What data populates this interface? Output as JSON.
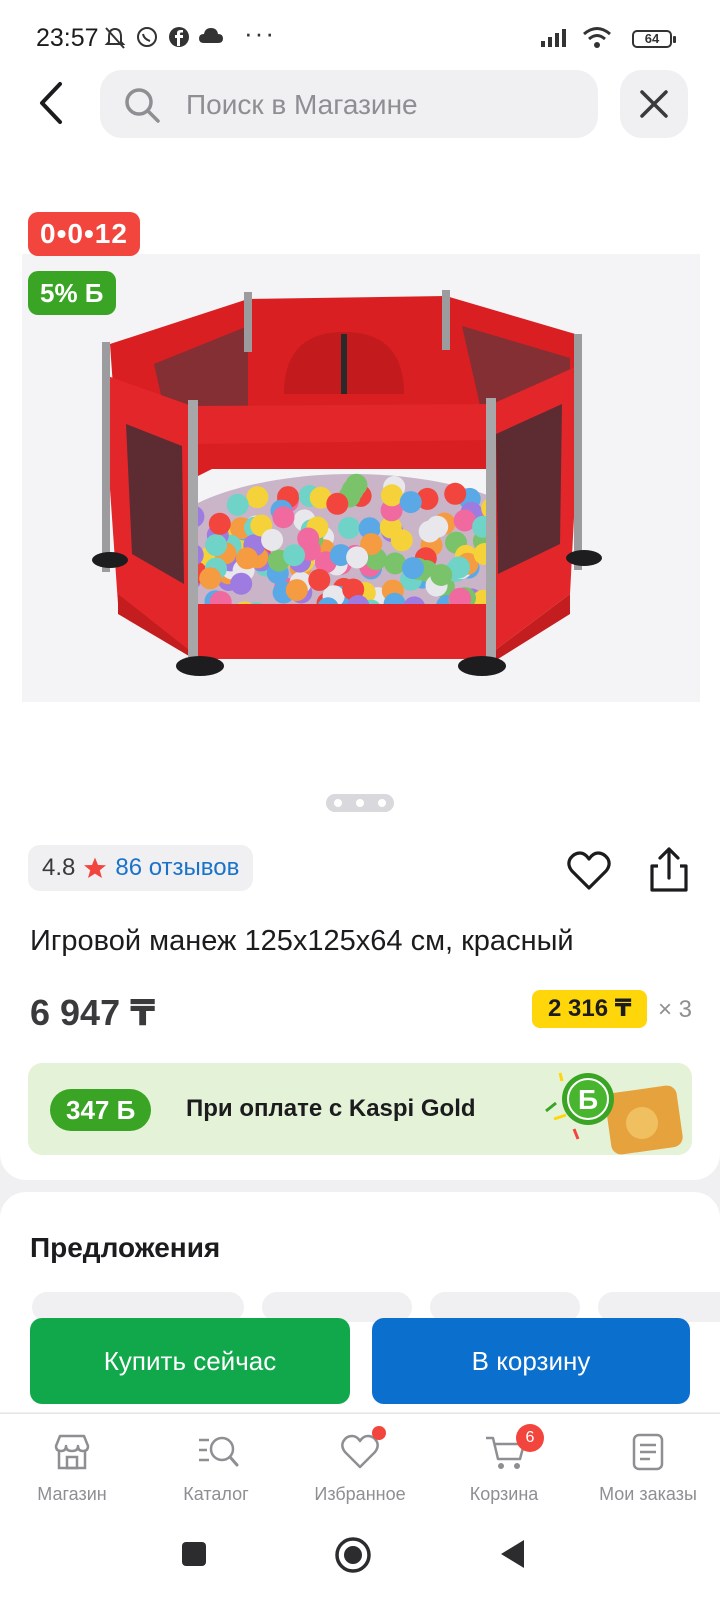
{
  "status_bar": {
    "time": "23:57",
    "battery": "64",
    "icons": [
      "mute-bell-icon",
      "whatsapp-icon",
      "facebook-icon",
      "cloud-icon",
      "more-icon",
      "signal-icon",
      "wifi-icon",
      "battery-icon"
    ],
    "more": "···"
  },
  "header": {
    "search_placeholder": "Поиск в Магазине"
  },
  "gallery": {
    "timer_badge": "0•0•12",
    "bonus_badge": "5% Б",
    "image_alt": "red hexagonal baby playpen with colorful balls",
    "slide_count": 3,
    "active_slide": 1
  },
  "product": {
    "rating": "4.8",
    "reviews": "86 отзывов",
    "title": "Игровой манеж 125x125x64 см, красный",
    "price": "6 947 ₸",
    "installment_price": "2 316 ₸",
    "installment_multiplier": "× 3"
  },
  "kaspi_gold": {
    "bonus_amount": "347 Б",
    "text": "При оплате с Kaspi Gold"
  },
  "offers": {
    "title": "Предложения"
  },
  "actions": {
    "buy_now": "Купить сейчас",
    "add_to_cart": "В корзину"
  },
  "bottom_nav": [
    {
      "label": "Магазин",
      "icon": "store-icon"
    },
    {
      "label": "Каталог",
      "icon": "catalog-search-icon"
    },
    {
      "label": "Избранное",
      "icon": "heart-icon",
      "dot": true
    },
    {
      "label": "Корзина",
      "icon": "cart-icon",
      "badge": "6"
    },
    {
      "label": "Мои заказы",
      "icon": "orders-icon"
    }
  ],
  "colors": {
    "accent_red": "#f2453d",
    "bonus_green": "#3aa524",
    "buy_green": "#11a84b",
    "cart_blue": "#0a6fcd",
    "installment_yellow": "#ffd60a",
    "link_blue": "#1a73c9"
  }
}
